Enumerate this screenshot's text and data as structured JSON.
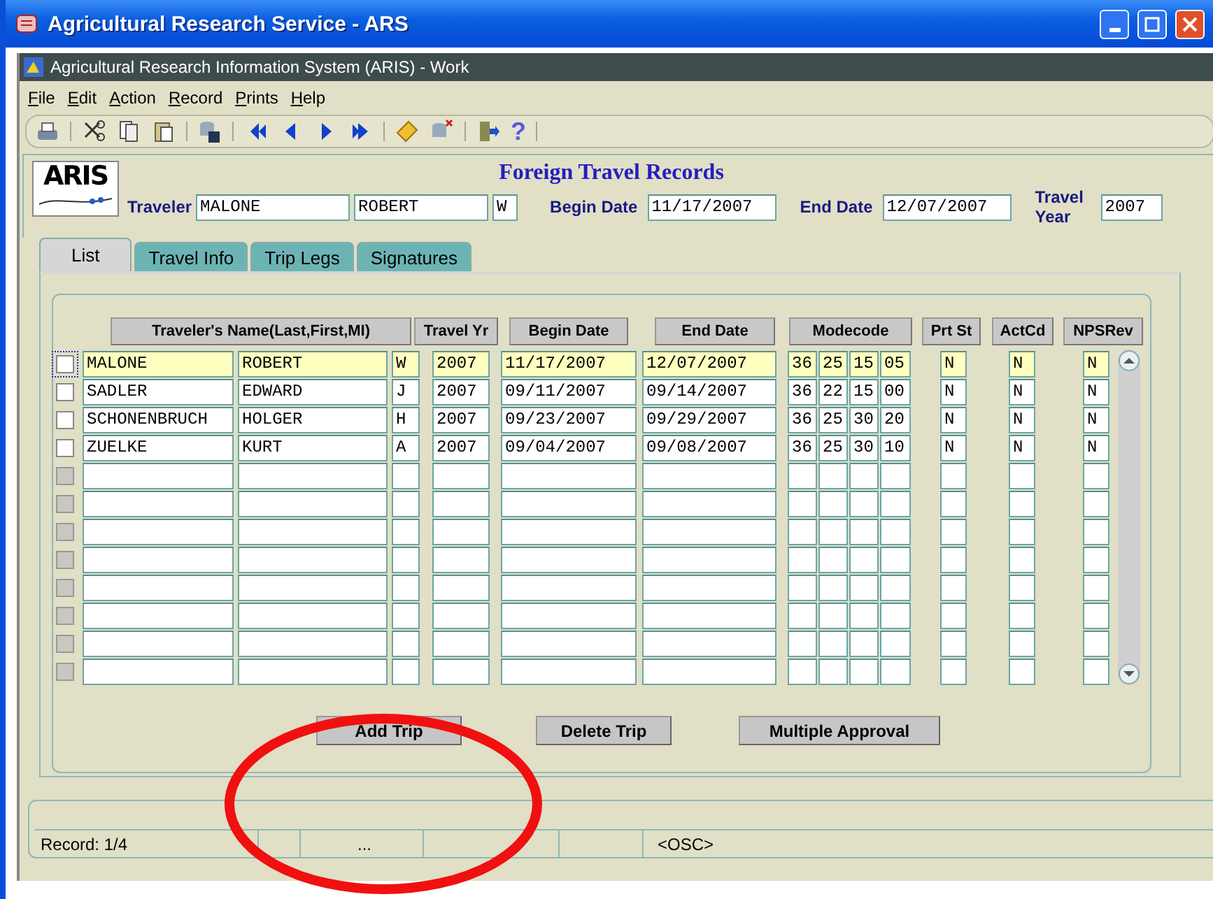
{
  "window": {
    "title": "Agricultural Research Service - ARS"
  },
  "child_window": {
    "title": "Agricultural Research Information System (ARIS) - Work"
  },
  "menu": [
    "File",
    "Edit",
    "Action",
    "Record",
    "Prints",
    "Help"
  ],
  "toolbar": {
    "help_glyph": "?"
  },
  "header": {
    "logo": "ARIS",
    "title": "Foreign Travel Records",
    "traveler_label": "Traveler",
    "last": "MALONE",
    "first": "ROBERT",
    "mi": "W",
    "begin_label": "Begin Date",
    "begin": "11/17/2007",
    "end_label": "End Date",
    "end": "12/07/2007",
    "year_label": "Travel Year",
    "year": "2007"
  },
  "tabs": [
    {
      "label": "List",
      "selected": true
    },
    {
      "label": "Travel Info",
      "selected": false
    },
    {
      "label": "Trip Legs",
      "selected": false
    },
    {
      "label": "Signatures",
      "selected": false
    }
  ],
  "table": {
    "columns": [
      "Traveler's Name(Last,First,MI)",
      "Travel Yr",
      "Begin Date",
      "End Date",
      "Modecode",
      "Prt St",
      "ActCd",
      "NPSRev"
    ],
    "rows": [
      {
        "selected": true,
        "checked": false,
        "last": "MALONE",
        "first": "ROBERT",
        "mi": "W",
        "year": "2007",
        "begin": "11/17/2007",
        "end": "12/07/2007",
        "modecode": [
          "36",
          "25",
          "15",
          "05"
        ],
        "prt": "N",
        "act": "N",
        "nps": "N"
      },
      {
        "selected": false,
        "checked": false,
        "last": "SADLER",
        "first": "EDWARD",
        "mi": "J",
        "year": "2007",
        "begin": "09/11/2007",
        "end": "09/14/2007",
        "modecode": [
          "36",
          "22",
          "15",
          "00"
        ],
        "prt": "N",
        "act": "N",
        "nps": "N"
      },
      {
        "selected": false,
        "checked": false,
        "last": "SCHONENBRUCH",
        "first": "HOLGER",
        "mi": "H",
        "year": "2007",
        "begin": "09/23/2007",
        "end": "09/29/2007",
        "modecode": [
          "36",
          "25",
          "30",
          "20"
        ],
        "prt": "N",
        "act": "N",
        "nps": "N"
      },
      {
        "selected": false,
        "checked": false,
        "last": "ZUELKE",
        "first": "KURT",
        "mi": "A",
        "year": "2007",
        "begin": "09/04/2007",
        "end": "09/08/2007",
        "modecode": [
          "36",
          "25",
          "30",
          "10"
        ],
        "prt": "N",
        "act": "N",
        "nps": "N"
      },
      {
        "kind": "blank",
        "disabled": true
      },
      {
        "kind": "blank",
        "disabled": true
      },
      {
        "kind": "blank",
        "disabled": true
      },
      {
        "kind": "blank",
        "disabled": true
      },
      {
        "kind": "blank",
        "disabled": true
      },
      {
        "kind": "blank",
        "disabled": true
      },
      {
        "kind": "blank",
        "disabled": true
      },
      {
        "kind": "blank",
        "disabled": true
      }
    ]
  },
  "buttons": [
    "Add Trip",
    "Delete Trip",
    "Multiple Approval"
  ],
  "status_bar": {
    "record": "Record: 1/4",
    "ellipsis": "...",
    "mode": "<OSC>"
  },
  "annotation": {
    "kind": "ellipse"
  }
}
